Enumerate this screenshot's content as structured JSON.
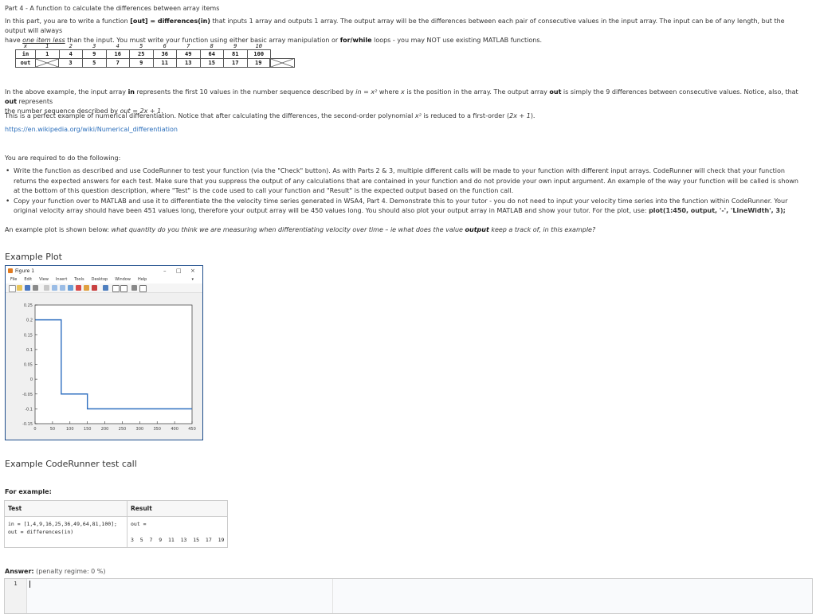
{
  "part_title": "Part 4 - A function to calculate the differences between array items",
  "intro": {
    "t1": "In this part, you are to write a function ",
    "sig": "[out] = differences(in)",
    "t2": " that inputs 1 array and outputs 1 array.  The output array will be the differences between each pair of consecutive values in the input array.  The input can be of any length, but the output will always",
    "t3": "have ",
    "emph": "one item less",
    "t4": " than the input. You must write your function using either basic array manipulation or ",
    "loops": "for/while",
    "t5": " loops - you may NOT use existing MATLAB functions."
  },
  "sequence_table": {
    "x_label": "x",
    "in_label": "in",
    "out_label": "out",
    "x": [
      "1",
      "2",
      "3",
      "4",
      "5",
      "6",
      "7",
      "8",
      "9",
      "10"
    ],
    "in": [
      "1",
      "4",
      "9",
      "16",
      "25",
      "36",
      "49",
      "64",
      "81",
      "100"
    ],
    "out": [
      "3",
      "5",
      "7",
      "9",
      "11",
      "13",
      "15",
      "17",
      "19"
    ]
  },
  "explain": {
    "p1a": "In the above example, the input array ",
    "p1b": "in",
    "p1c": " represents the first 10 values in the number sequence described by ",
    "p1d": "in = x²",
    "p1e": " where ",
    "p1f": "x",
    "p1g": " is the position in the array.  The output array ",
    "p1h": "out",
    "p1i": " is simply the 9 differences between consecutive values.  Notice, also, that ",
    "p1j": "out",
    "p1k": " represents",
    "p1l": "the number sequence described by ",
    "p1m": "out = 2x + 1",
    "p1n": ".",
    "p2a": "This is a perfect example of numerical differentiation.  Notice that after calculating the differences, the second-order polynomial ",
    "p2b": "x²",
    "p2c": " is reduced to a first-order (",
    "p2d": "2x + 1",
    "p2e": ").",
    "link": "https://en.wikipedia.org/wiki/Numerical_differentiation"
  },
  "required": {
    "lead": "You are required to do the following:",
    "b1": "Write the function as described and use CodeRunner to test your function (via the \"Check\" button).  As with Parts 2 & 3, multiple different calls will be made to your function with different input arrays.  CodeRunner will check that your function returns the expected answers for each test.  Make sure that you suppress the output of any calculations that are contained in your function and do not provide your own input argument.  An example of the way your function will be called is shown at the bottom of this question description, where \"Test\" is the code used to call your function and \"Result\" is the expected output based on the function call.",
    "b2a": "Copy your function over to MATLAB and use it to differentiate the the velocity time series generated in WSA4, Part 4.  Demonstrate this to your tutor - you do not need to input your velocity time series into the function within CodeRunner.  Your original velocity array should have been 451 values long, therefore your output array will be 450 values long.  You should also plot your output array in MATLAB and show your tutor.  For the plot, use: ",
    "b2b": "plot(1:450, output, '-', 'LineWidth', 3);"
  },
  "example_note": {
    "a": "An example plot is shown below: ",
    "b": "what quantity do you think we are measuring when differentiating velocity over time – ie what does the value ",
    "c": "output",
    "d": " keep a track of, in this example?"
  },
  "example_plot_heading": "Example Plot",
  "figure_window": {
    "title": "Figure 1",
    "minimize": "–",
    "maximize": "□",
    "close": "×",
    "menu": [
      "File",
      "Edit",
      "View",
      "Insert",
      "Tools",
      "Desktop",
      "Window",
      "Help"
    ],
    "menu_arrow": "▾"
  },
  "chart_data": {
    "type": "line",
    "title": "",
    "xlabel": "",
    "ylabel": "",
    "xlim": [
      0,
      450
    ],
    "ylim": [
      -0.15,
      0.25
    ],
    "xticks": [
      0,
      50,
      100,
      150,
      200,
      250,
      300,
      350,
      400,
      450
    ],
    "yticks": [
      0.25,
      0.2,
      0.15,
      0.1,
      0.05,
      0,
      -0.05,
      -0.1,
      -0.15
    ],
    "ytick_labels": [
      "0.25",
      "0.2",
      "0.15",
      "0.1",
      "0.05",
      "0",
      "-0.05",
      "-0.1",
      "-0.15"
    ],
    "grid": false,
    "line_color": "#2f6fc0",
    "series": [
      {
        "x": [
          1,
          75,
          75,
          150,
          150,
          450
        ],
        "y": [
          0.2,
          0.2,
          -0.05,
          -0.05,
          -0.1,
          -0.1
        ]
      }
    ]
  },
  "coderunner_heading": "Example CodeRunner test call",
  "for_example": "For example:",
  "example_table": {
    "test_header": "Test",
    "result_header": "Result",
    "test_line1": "in = [1,4,9,16,25,36,49,64,81,100];",
    "test_line2": "out = differences(in)",
    "result_line1": "out =",
    "result_line2": "",
    "result_line3": "3  5  7  9  11  13  15  17  19"
  },
  "answer": {
    "label": "Answer:",
    "penalty": "(penalty regime: 0 %)",
    "line_number": "1"
  }
}
